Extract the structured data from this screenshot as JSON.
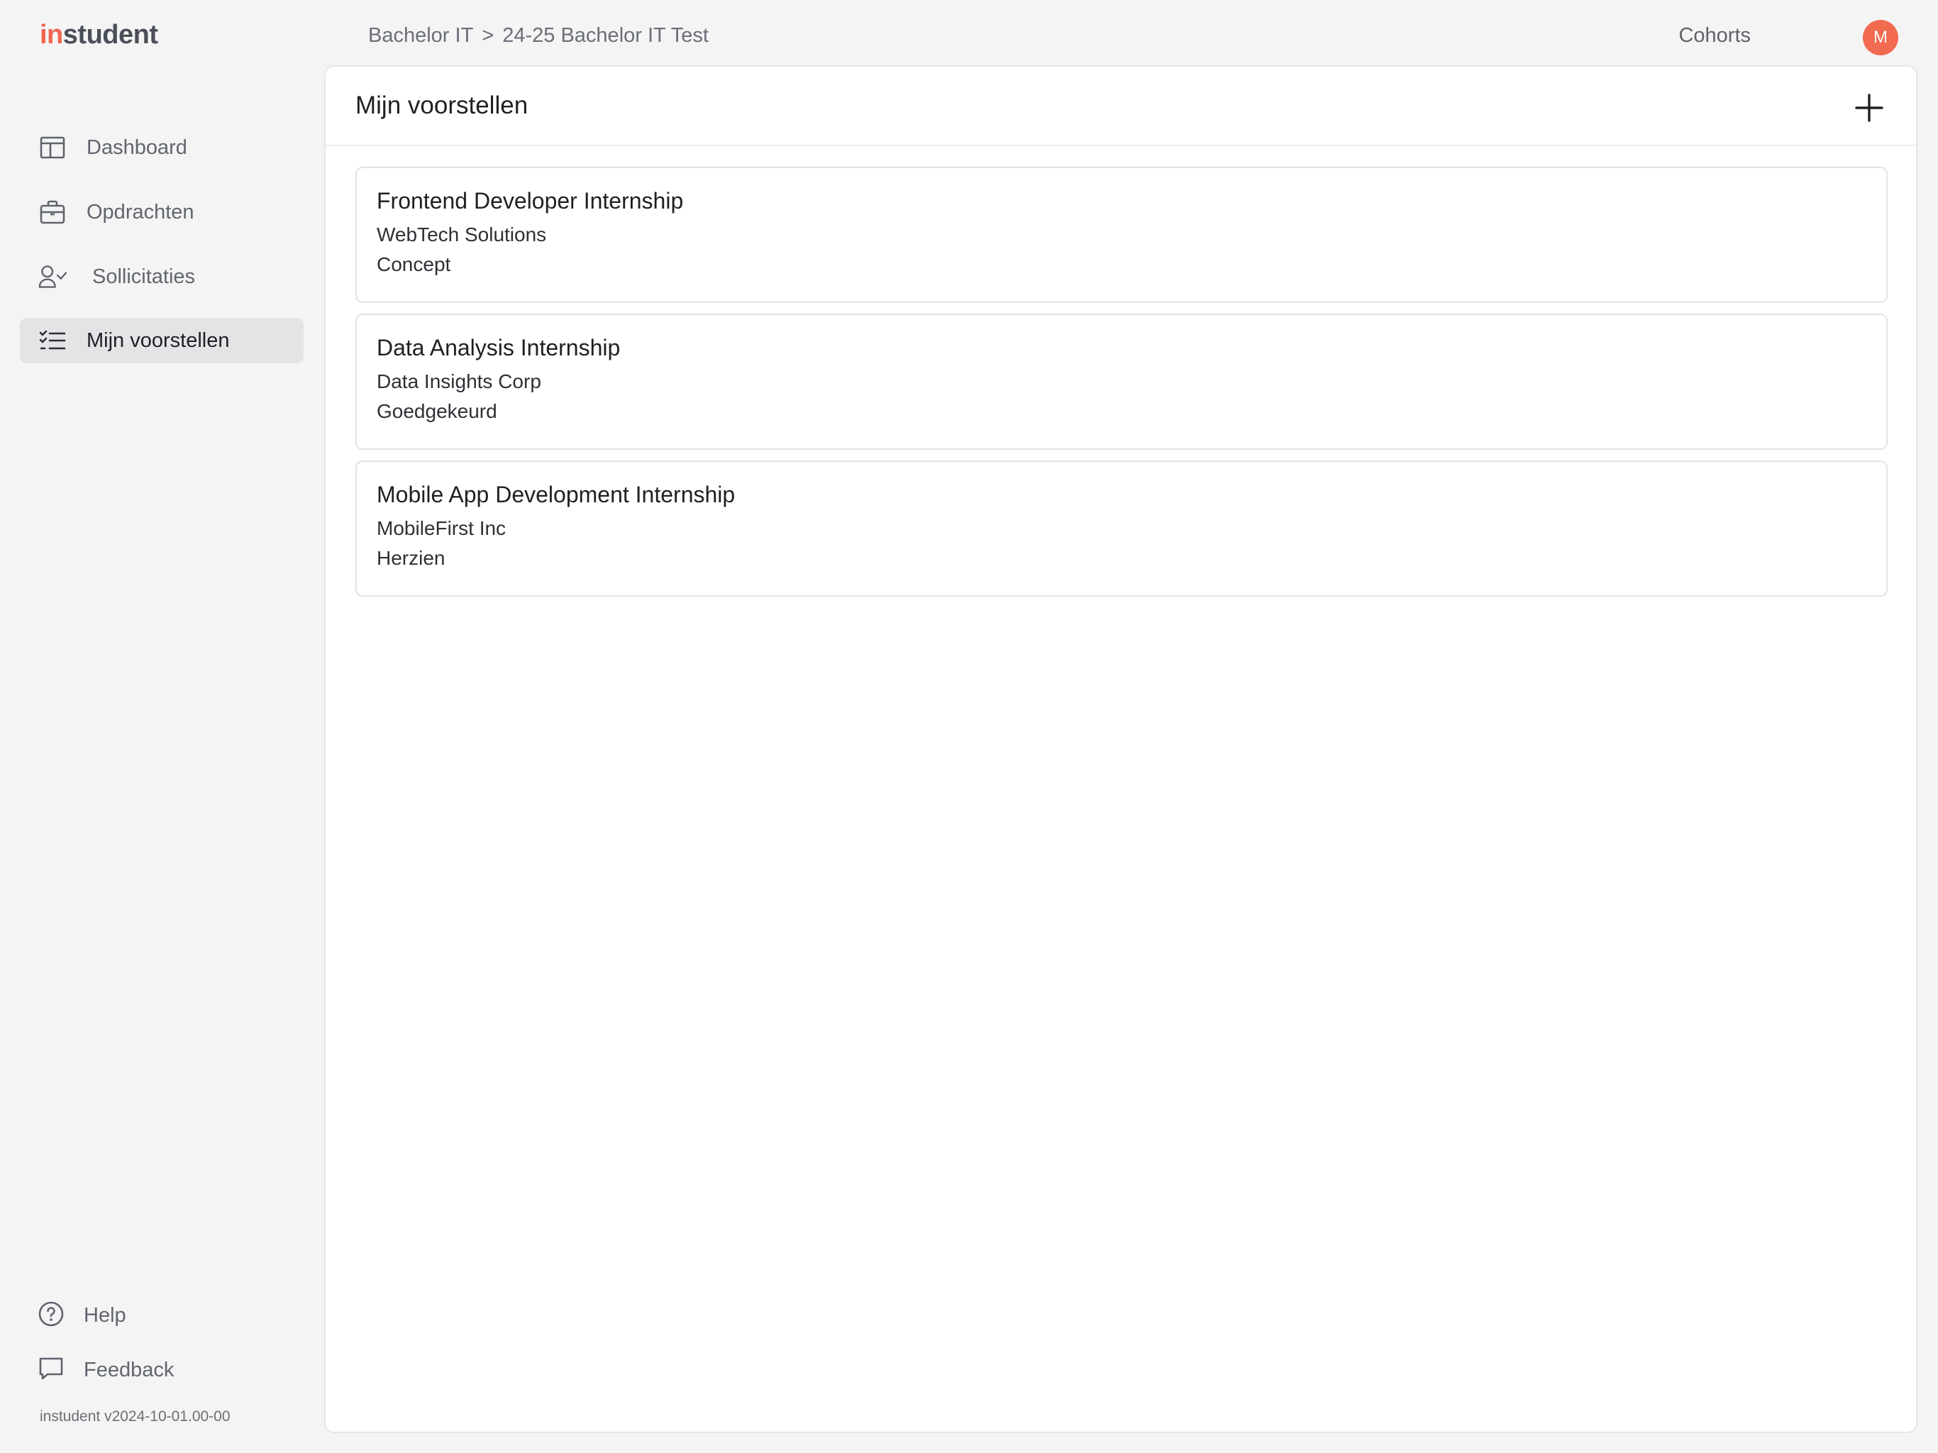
{
  "brand": {
    "logo_prefix": "in",
    "logo_suffix": "student",
    "accent_color": "#f1644e"
  },
  "header": {
    "breadcrumb": [
      "Bachelor IT",
      ">",
      "24-25 Bachelor IT Test"
    ],
    "cohorts_label": "Cohorts",
    "avatar_initial": "M"
  },
  "sidebar": {
    "items": [
      {
        "label": "Dashboard",
        "icon": "layout-icon",
        "active": false
      },
      {
        "label": "Opdrachten",
        "icon": "briefcase-icon",
        "active": false
      },
      {
        "label": "Sollicitaties",
        "icon": "user-check-icon",
        "active": false
      },
      {
        "label": "Mijn voorstellen",
        "icon": "list-checks-icon",
        "active": true
      }
    ],
    "bottom": [
      {
        "label": "Help",
        "icon": "help-circle-icon"
      },
      {
        "label": "Feedback",
        "icon": "message-square-icon"
      }
    ],
    "version": "instudent v2024-10-01.00-00"
  },
  "main": {
    "title": "Mijn voorstellen",
    "add_icon": "plus-icon",
    "proposals": [
      {
        "title": "Frontend Developer Internship",
        "company": "WebTech Solutions",
        "status": "Concept"
      },
      {
        "title": "Data Analysis Internship",
        "company": "Data Insights Corp",
        "status": "Goedgekeurd"
      },
      {
        "title": "Mobile App Development Internship",
        "company": "MobileFirst Inc",
        "status": "Herzien"
      }
    ]
  }
}
